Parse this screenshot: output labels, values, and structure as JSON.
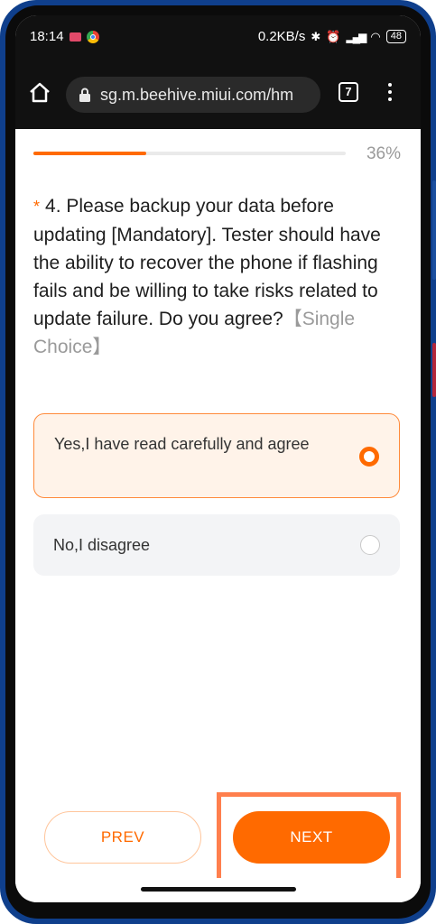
{
  "status_bar": {
    "time": "18:14",
    "network_speed": "0.2KB/s",
    "battery": "48"
  },
  "browser": {
    "url": "sg.m.beehive.miui.com/hm",
    "tab_count": "7"
  },
  "survey": {
    "progress_percent": 36,
    "progress_label": "36%",
    "question_marker": "*",
    "question_text": "4. Please backup your data before updating [Mandatory]. Tester should have the ability to recover the phone if flashing fails and be willing to take risks related to update failure. Do you agree?",
    "question_type": "【Single Choice】",
    "options": [
      {
        "label": "Yes,I have read carefully and agree",
        "selected": true
      },
      {
        "label": "No,I disagree",
        "selected": false
      }
    ],
    "prev_label": "PREV",
    "next_label": "NEXT"
  },
  "colors": {
    "accent": "#ff6a00",
    "selected_bg": "#fff3e9",
    "option_bg": "#f3f4f6",
    "browser_bar": "#111111",
    "highlight": "#ff7f4d"
  },
  "icons": [
    "home-icon",
    "lock-icon",
    "tabs-icon",
    "more-menu-icon",
    "radio-selected-icon",
    "radio-unselected-icon"
  ]
}
